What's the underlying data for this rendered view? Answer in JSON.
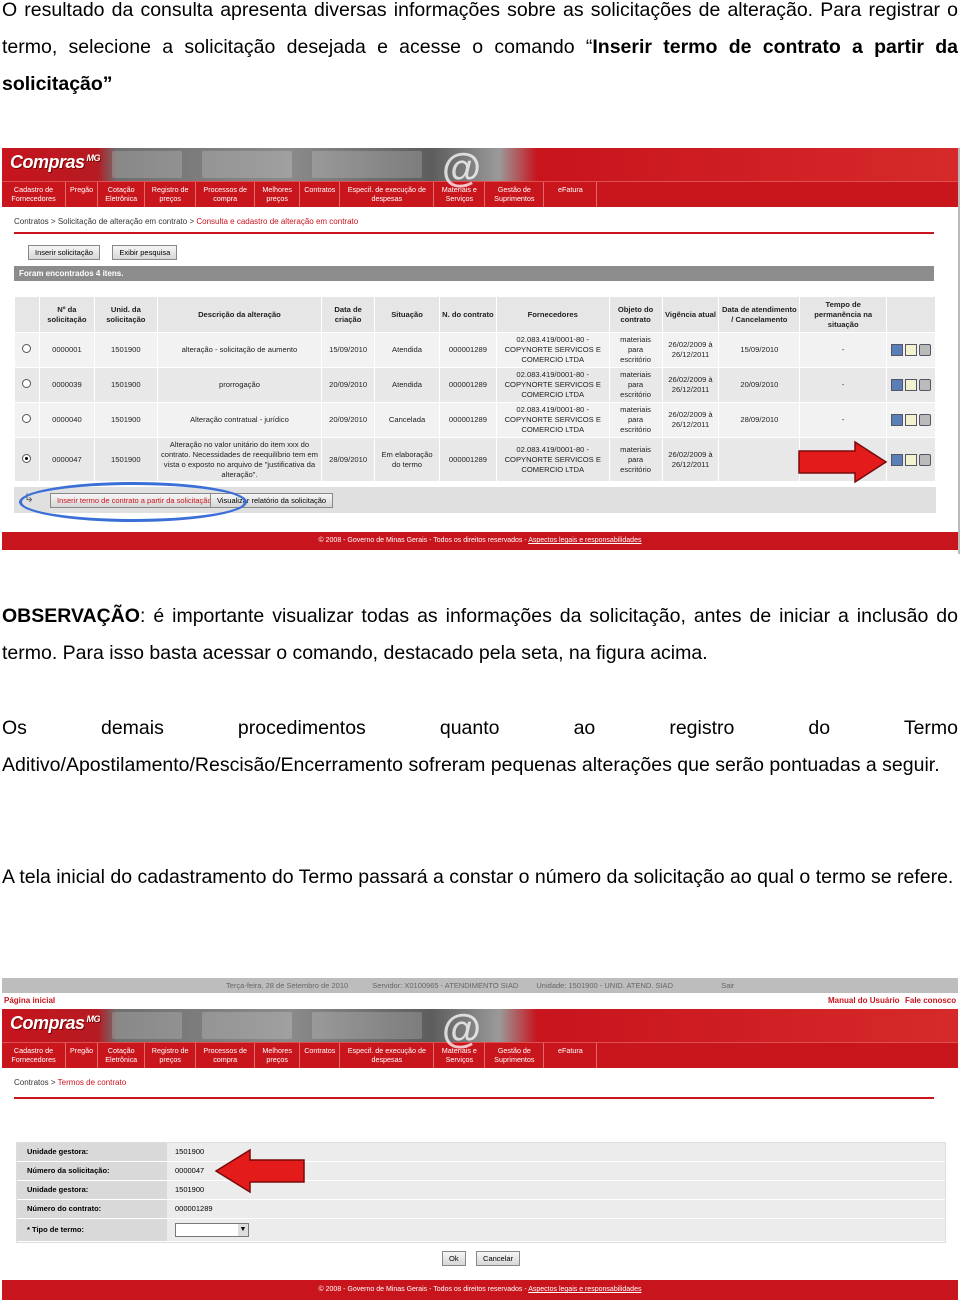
{
  "doc": {
    "para1_plain": "O resultado da consulta apresenta diversas informações sobre as solicitações de alteração. Para registrar o termo, selecione a solicitação desejada e acesse o comando “",
    "para1_bold": "Inserir termo de contrato a partir da solicitação”",
    "obs_label": "OBSERVAÇÃO",
    "obs_text": ": é importante visualizar todas as informações da solicitação, antes de iniciar a inclusão do termo. Para isso basta acessar o comando, destacado pela seta, na figura acima.",
    "para3_first_line": "Os demais procedimentos quanto ao registro do Termo",
    "para3_rest": "Aditivo/Apostilamento/Rescisão/Encerramento sofreram pequenas alterações que serão pontuadas a seguir.",
    "para4": "A tela inicial do cadastramento do Termo passará a constar o número da solicitação ao qual o termo se refere."
  },
  "portal": {
    "logo": "Compras",
    "logo_sub": "MG",
    "menu": [
      "Cadastro de Fornecedores",
      "Pregão",
      "Cotação Eletrônica",
      "Registro de preços",
      "Processos de compra",
      "Melhores preços",
      "Contratos",
      "Especif. de execução de despesas",
      "Materiais e Serviços",
      "Gestão de Suprimentos",
      "eFatura"
    ],
    "footer_text": "© 2008 - Governo de Minas Gerais - Todos os direitos reservados - ",
    "footer_link": "Aspectos legais e responsabilidades"
  },
  "screen1": {
    "breadcrumb": [
      "Contratos",
      "Solicitação de alteração em contrato"
    ],
    "breadcrumb_current": "Consulta e cadastro de alteração em contrato",
    "btn_insert": "Inserir solicitação",
    "btn_show_search": "Exibir pesquisa",
    "result_count": "Foram encontrados 4 itens.",
    "columns": [
      "Nº da solicitação",
      "Unid. da solicitação",
      "Descrição da alteração",
      "Data de criação",
      "Situação",
      "N. do contrato",
      "Fornecedores",
      "Objeto do contrato",
      "Vigência atual",
      "Data de atendimento / Cancelamento",
      "Tempo de permanência na situação"
    ],
    "rows": [
      {
        "selected": false,
        "num": "0000001",
        "unid": "1501900",
        "desc": "alteração - solicitação de aumento",
        "data": "15/09/2010",
        "sit": "Atendida",
        "contrato": "000001289",
        "forn": "02.083.419/0001-80 - COPYNORTE SERVICOS E COMERCIO LTDA",
        "obj": "materiais para escritório",
        "vig": "26/02/2009 à 26/12/2011",
        "atend": "15/09/2010",
        "tempo": "-"
      },
      {
        "selected": false,
        "num": "0000039",
        "unid": "1501900",
        "desc": "prorrogação",
        "data": "20/09/2010",
        "sit": "Atendida",
        "contrato": "000001289",
        "forn": "02.083.419/0001-80 - COPYNORTE SERVICOS E COMERCIO LTDA",
        "obj": "materiais para escritório",
        "vig": "26/02/2009 à 26/12/2011",
        "atend": "20/09/2010",
        "tempo": "-"
      },
      {
        "selected": false,
        "num": "0000040",
        "unid": "1501900",
        "desc": "Alteração contratual - jurídico",
        "data": "20/09/2010",
        "sit": "Cancelada",
        "contrato": "000001289",
        "forn": "02.083.419/0001-80 - COPYNORTE SERVICOS E COMERCIO LTDA",
        "obj": "materiais para escritório",
        "vig": "26/02/2009 à 26/12/2011",
        "atend": "28/09/2010",
        "tempo": "-"
      },
      {
        "selected": true,
        "num": "0000047",
        "unid": "1501900",
        "desc": "Alteração no valor unitário do item xxx do contrato. Necessidades de reequilíbrio tem em vista o exposto no arquivo de \"justificativa da alteração\".",
        "data": "28/09/2010",
        "sit": "Em elaboração do termo",
        "contrato": "000001289",
        "forn": "02.083.419/0001-80 - COPYNORTE SERVICOS E COMERCIO LTDA",
        "obj": "materiais para escritório",
        "vig": "26/02/2009 à 26/12/2011",
        "atend": "",
        "tempo": "-"
      }
    ],
    "action_insert_term": "Inserir termo de contrato a partir da solicitação",
    "action_view_report": "Visualizar relatório da solicitação"
  },
  "screen2": {
    "top_date": "Terça-feira, 28 de Setembro de 2010",
    "top_server": "Servidor: X0100965 - ATENDIMENTO SIAD",
    "top_unit": "Unidade: 1501900 - UNID. ATEND. SIAD",
    "top_exit": "Sair",
    "home": "Página inicial",
    "manual": "Manual do Usuário",
    "contact": "Fale conosco",
    "breadcrumb": [
      "Contratos"
    ],
    "breadcrumb_current": "Termos de contrato",
    "fields": [
      {
        "label": "Unidade gestora:",
        "value": "1501900"
      },
      {
        "label": "Número da solicitação:",
        "value": "0000047"
      },
      {
        "label": "Unidade gestora:",
        "value": "1501900"
      },
      {
        "label": "Número do contrato:",
        "value": "000001289"
      }
    ],
    "type_label": "* Tipo de termo:",
    "type_value": "",
    "ok": "Ok",
    "cancel": "Cancelar"
  },
  "colors": {
    "portal_red": "#c8141d",
    "arrow_red": "#e31b1b",
    "highlight_oval": "#3a6fd8"
  }
}
